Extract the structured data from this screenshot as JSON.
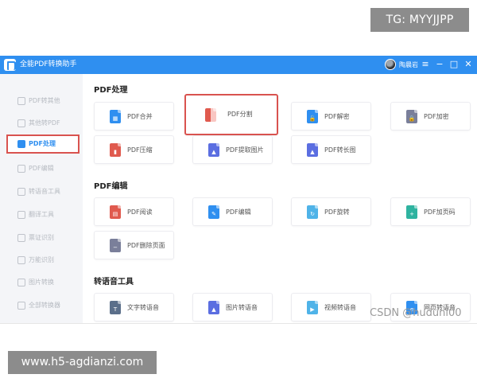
{
  "overlays": {
    "tg_badge": "TG: MYYJJPP",
    "url_badge": "www.h5-agdianzi.com",
    "csdn_watermark": "CSDN @huduni00"
  },
  "window": {
    "title": "全能PDF转换助手",
    "username": "陶晨岩",
    "controls": {
      "menu": "≡",
      "minimize": "−",
      "maximize": "□",
      "close": "✕"
    },
    "accent_color": "#2f8ff0",
    "highlight_color": "#d9534f"
  },
  "sidebar": {
    "items": [
      {
        "label": "PDF转其他"
      },
      {
        "label": "其他转PDF"
      },
      {
        "label": "PDF处理",
        "active": true
      },
      {
        "label": "PDF编辑"
      },
      {
        "label": "转语音工具"
      },
      {
        "label": "翻译工具"
      },
      {
        "label": "票证识别"
      },
      {
        "label": "万能识别"
      },
      {
        "label": "图片转换"
      },
      {
        "label": "全部转换器"
      }
    ]
  },
  "sections": [
    {
      "title": "PDF处理",
      "tools": [
        {
          "label": "PDF合并",
          "icon": "merge-icon",
          "color": "#2f8ff0"
        },
        {
          "label": "PDF分割",
          "icon": "split-icon",
          "color": "#f08a8a",
          "highlighted": true
        },
        {
          "label": "PDF解密",
          "icon": "unlock-icon",
          "color": "#2f8ff0"
        },
        {
          "label": "PDF加密",
          "icon": "lock-icon",
          "color": "#7a7f9a"
        },
        {
          "label": "PDF压缩",
          "icon": "compress-icon",
          "color": "#e05a4e"
        },
        {
          "label": "PDF提取图片",
          "icon": "image-extract-icon",
          "color": "#5b6ee1"
        },
        {
          "label": "PDF转长图",
          "icon": "long-image-icon",
          "color": "#5b6ee1"
        }
      ]
    },
    {
      "title": "PDF编辑",
      "tools": [
        {
          "label": "PDF阅读",
          "icon": "read-icon",
          "color": "#e05a4e"
        },
        {
          "label": "PDF编辑",
          "icon": "edit-icon",
          "color": "#2f8ff0"
        },
        {
          "label": "PDF旋转",
          "icon": "rotate-icon",
          "color": "#4fb3e8"
        },
        {
          "label": "PDF加页码",
          "icon": "page-number-icon",
          "color": "#2fb3a0"
        },
        {
          "label": "PDF删除页面",
          "icon": "delete-page-icon",
          "color": "#7a7f9a"
        }
      ]
    },
    {
      "title": "转语音工具",
      "tools": [
        {
          "label": "文字转语音",
          "icon": "text-to-speech-icon",
          "color": "#5b6f8a"
        },
        {
          "label": "图片转语音",
          "icon": "image-to-speech-icon",
          "color": "#5b6ee1"
        },
        {
          "label": "视频转语音",
          "icon": "video-to-speech-icon",
          "color": "#4fb3e8"
        },
        {
          "label": "网页转语音",
          "icon": "web-to-speech-icon",
          "color": "#2f8ff0"
        }
      ]
    }
  ]
}
